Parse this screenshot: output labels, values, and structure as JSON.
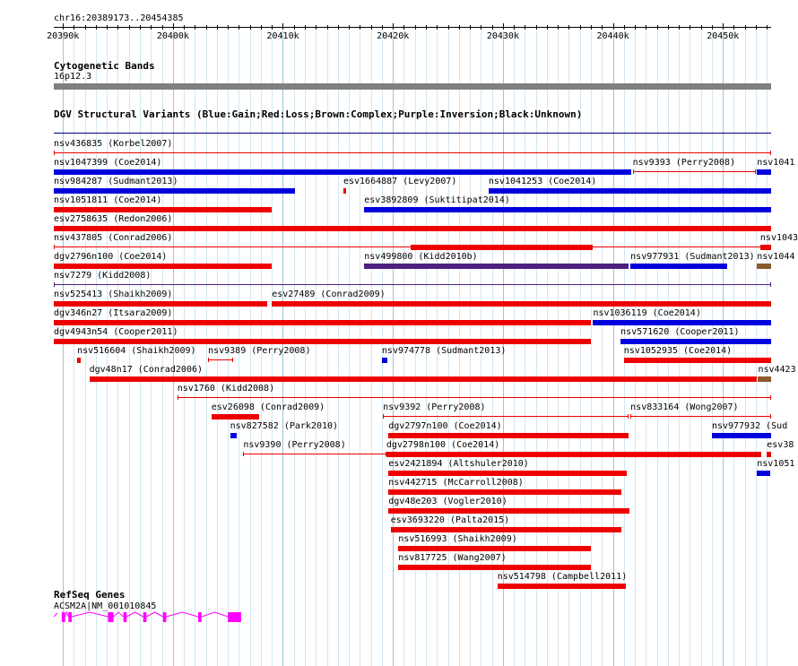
{
  "ruler": {
    "region": "chr16:20389173..20454385",
    "start": 20389173,
    "end": 20454385,
    "ticks": [
      {
        "label": "20390k",
        "pos": 20390000
      },
      {
        "label": "20400k",
        "pos": 20400000
      },
      {
        "label": "20410k",
        "pos": 20410000
      },
      {
        "label": "20420k",
        "pos": 20420000
      },
      {
        "label": "20430k",
        "pos": 20430000
      },
      {
        "label": "20440k",
        "pos": 20440000
      },
      {
        "label": "20450k",
        "pos": 20450000
      }
    ]
  },
  "cytoband": {
    "title": "Cytogenetic Bands",
    "band": "16p12.3"
  },
  "dgv": {
    "title": "DGV Structural Variants (Blue:Gain;Red:Loss;Brown:Complex;Purple:Inversion;Black:Unknown)",
    "colors": {
      "gain": "#0000dd",
      "loss": "#ee0000",
      "complex": "#8b5a2b",
      "inversion": "#4b2080",
      "unknown": "#000000"
    },
    "features": [
      {
        "label": "nsv436835 (Korbel2007)",
        "row": 0,
        "type": "loss",
        "style": "line",
        "start": 20389173,
        "end": 20454385
      },
      {
        "label": "nsv1047399 (Coe2014)",
        "row": 1,
        "type": "gain",
        "style": "bar",
        "start": 20389173,
        "end": 20441700
      },
      {
        "label": "nsv9393 (Perry2008)",
        "row": 1,
        "type": "loss",
        "style": "line",
        "start": 20441800,
        "end": 20453000
      },
      {
        "label": "nsv1041",
        "row": 1,
        "type": "gain",
        "style": "bar",
        "start": 20453100,
        "end": 20454385
      },
      {
        "label": "nsv984287 (Sudmant2013)",
        "row": 2,
        "type": "gain",
        "style": "bar",
        "start": 20389173,
        "end": 20411100
      },
      {
        "label": "esv1664887 (Levy2007)",
        "row": 2,
        "type": "loss",
        "style": "bar",
        "start": 20415500,
        "end": 20415700
      },
      {
        "label": "nsv1041253 (Coe2014)",
        "row": 2,
        "type": "gain",
        "style": "bar",
        "start": 20428700,
        "end": 20454385
      },
      {
        "label": "nsv1051811 (Coe2014)",
        "row": 3,
        "type": "loss",
        "style": "bar",
        "start": 20389173,
        "end": 20409000
      },
      {
        "label": "esv3892809 (Suktitipat2014)",
        "row": 3,
        "type": "gain",
        "style": "bar",
        "start": 20417400,
        "end": 20454385
      },
      {
        "label": "esv2758635 (Redon2006)",
        "row": 4,
        "type": "loss",
        "style": "bar",
        "start": 20389173,
        "end": 20454385
      },
      {
        "label": "nsv437805 (Conrad2006)",
        "row": 5,
        "type": "loss",
        "style": "line",
        "start": 20389173,
        "end": 20454385
      },
      {
        "label": "",
        "row": 5,
        "type": "loss",
        "style": "bar",
        "start": 20421600,
        "end": 20438200
      },
      {
        "label": "nsv1043",
        "row": 5,
        "type": "loss",
        "style": "bar",
        "start": 20453400,
        "end": 20454385
      },
      {
        "label": "dgv2796n100 (Coe2014)",
        "row": 6,
        "type": "loss",
        "style": "bar",
        "start": 20389173,
        "end": 20409000
      },
      {
        "label": "nsv499800 (Kidd2010b)",
        "row": 6,
        "type": "inversion",
        "style": "bar",
        "start": 20417400,
        "end": 20441400
      },
      {
        "label": "nsv977931 (Sudmant2013)",
        "row": 6,
        "type": "gain",
        "style": "bar",
        "start": 20441600,
        "end": 20450400
      },
      {
        "label": "nsv1044",
        "row": 6,
        "type": "complex",
        "style": "bar",
        "start": 20453100,
        "end": 20454385
      },
      {
        "label": "nsv7279 (Kidd2008)",
        "row": 7,
        "type": "inversion",
        "style": "line",
        "start": 20389173,
        "end": 20454385
      },
      {
        "label": "nsv525413 (Shaikh2009)",
        "row": 8,
        "type": "loss",
        "style": "bar",
        "start": 20389173,
        "end": 20408600
      },
      {
        "label": "esv27489 (Conrad2009)",
        "row": 8,
        "type": "loss",
        "style": "bar",
        "start": 20409000,
        "end": 20454385
      },
      {
        "label": "dgv346n27 (Itsara2009)",
        "row": 9,
        "type": "loss",
        "style": "bar",
        "start": 20389173,
        "end": 20438000
      },
      {
        "label": "nsv1036119 (Coe2014)",
        "row": 9,
        "type": "gain",
        "style": "bar",
        "start": 20438200,
        "end": 20454385
      },
      {
        "label": "dgv4943n54 (Cooper2011)",
        "row": 10,
        "type": "loss",
        "style": "bar",
        "start": 20389173,
        "end": 20438000
      },
      {
        "label": "nsv571620 (Cooper2011)",
        "row": 10,
        "type": "gain",
        "style": "bar",
        "start": 20440700,
        "end": 20454385
      },
      {
        "label": "nsv516604 (Shaikh2009)",
        "row": 11,
        "type": "loss",
        "style": "bar",
        "start": 20391300,
        "end": 20391600
      },
      {
        "label": "nsv9389 (Perry2008)",
        "row": 11,
        "type": "loss",
        "style": "line",
        "start": 20403200,
        "end": 20405500
      },
      {
        "label": "nsv974778 (Sudmant2013)",
        "row": 11,
        "type": "gain",
        "style": "bar",
        "start": 20419000,
        "end": 20419500
      },
      {
        "label": "nsv1052935 (Coe2014)",
        "row": 11,
        "type": "loss",
        "style": "bar",
        "start": 20441000,
        "end": 20454385
      },
      {
        "label": "dgv48n17 (Conrad2006)",
        "row": 12,
        "type": "loss",
        "style": "bar",
        "start": 20392400,
        "end": 20453100
      },
      {
        "label": "nsv4423",
        "row": 12,
        "type": "complex",
        "style": "bar",
        "start": 20453200,
        "end": 20454385
      },
      {
        "label": "nsv1760 (Kidd2008)",
        "row": 13,
        "type": "loss",
        "style": "line",
        "start": 20400400,
        "end": 20454385
      },
      {
        "label": "esv26098 (Conrad2009)",
        "row": 14,
        "type": "loss",
        "style": "bar",
        "start": 20403500,
        "end": 20407800
      },
      {
        "label": "nsv9392 (Perry2008)",
        "row": 14,
        "type": "loss",
        "style": "line",
        "start": 20419100,
        "end": 20441400
      },
      {
        "label": "nsv833164 (Wong2007)",
        "row": 14,
        "type": "loss",
        "style": "line",
        "start": 20441600,
        "end": 20454385
      },
      {
        "label": "nsv827582 (Park2010)",
        "row": 15,
        "type": "gain",
        "style": "bar",
        "start": 20405200,
        "end": 20405800
      },
      {
        "label": "dgv2797n100 (Coe2014)",
        "row": 15,
        "type": "loss",
        "style": "bar",
        "start": 20419600,
        "end": 20441400
      },
      {
        "label": "nsv977932 (Sud",
        "row": 15,
        "type": "gain",
        "style": "bar",
        "start": 20449000,
        "end": 20454385
      },
      {
        "label": "nsv9390 (Perry2008)",
        "row": 16,
        "type": "loss",
        "style": "line",
        "start": 20406400,
        "end": 20419400
      },
      {
        "label": "dgv2798n100 (Coe2014)",
        "row": 16,
        "type": "loss",
        "style": "bar",
        "start": 20419400,
        "end": 20453500
      },
      {
        "label": "esv38",
        "row": 16,
        "type": "loss",
        "style": "bar",
        "start": 20454000,
        "end": 20454385
      },
      {
        "label": "esv2421894 (Altshuler2010)",
        "row": 17,
        "type": "loss",
        "style": "bar",
        "start": 20419600,
        "end": 20441300
      },
      {
        "label": "nsv1051",
        "row": 17,
        "type": "gain",
        "style": "bar",
        "start": 20453100,
        "end": 20454300
      },
      {
        "label": "nsv442715 (McCarroll2008)",
        "row": 18,
        "type": "loss",
        "style": "bar",
        "start": 20419600,
        "end": 20440800
      },
      {
        "label": "dgv48e203 (Vogler2010)",
        "row": 19,
        "type": "loss",
        "style": "bar",
        "start": 20419600,
        "end": 20441500
      },
      {
        "label": "esv3693220 (Palta2015)",
        "row": 20,
        "type": "loss",
        "style": "bar",
        "start": 20419800,
        "end": 20440800
      },
      {
        "label": "nsv516993 (Shaikh2009)",
        "row": 21,
        "type": "loss",
        "style": "bar",
        "start": 20420500,
        "end": 20438000
      },
      {
        "label": "nsv817725 (Wang2007)",
        "row": 22,
        "type": "loss",
        "style": "bar",
        "start": 20420500,
        "end": 20438000
      },
      {
        "label": "nsv514798 (Campbell2011)",
        "row": 23,
        "type": "loss",
        "style": "bar",
        "start": 20429500,
        "end": 20441200
      }
    ]
  },
  "refseq": {
    "title": "RefSeq Genes",
    "gene": "ACSM2A|NM_001010845",
    "color": "#ff00ff",
    "start": 20389173,
    "end": 20406200,
    "exons": [
      [
        20389900,
        20390200
      ],
      [
        20390500,
        20390800
      ],
      [
        20394100,
        20394600
      ],
      [
        20395500,
        20395800
      ],
      [
        20397300,
        20397600
      ],
      [
        20399100,
        20399400
      ],
      [
        20402300,
        20402600
      ],
      [
        20405000,
        20406200
      ]
    ]
  }
}
